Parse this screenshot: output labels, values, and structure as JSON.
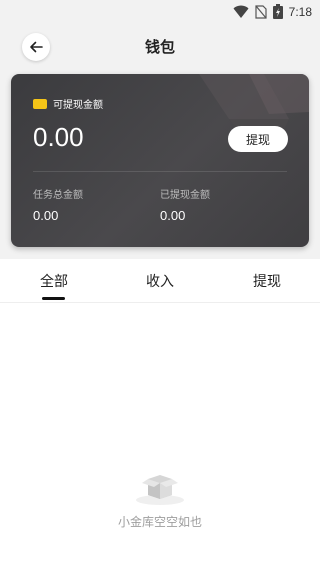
{
  "status_bar": {
    "time": "7:18",
    "icons": [
      "wifi-icon",
      "no-sim-icon",
      "battery-icon"
    ]
  },
  "header": {
    "title": "钱包",
    "back_icon": "arrow-left-icon"
  },
  "wallet_card": {
    "label": "可提现金额",
    "amount": "0.00",
    "withdraw_button": "提现",
    "stats": [
      {
        "label": "任务总金额",
        "value": "0.00"
      },
      {
        "label": "已提现金额",
        "value": "0.00"
      }
    ]
  },
  "tabs": [
    {
      "label": "全部",
      "active": true
    },
    {
      "label": "收入",
      "active": false
    },
    {
      "label": "提现",
      "active": false
    }
  ],
  "empty_state": {
    "icon": "empty-box-icon",
    "message": "小金库空空如也"
  },
  "colors": {
    "page_bg": "#f2f2f2",
    "card_bg": "#3b3b3e",
    "wallet_icon": "#f5c518"
  }
}
